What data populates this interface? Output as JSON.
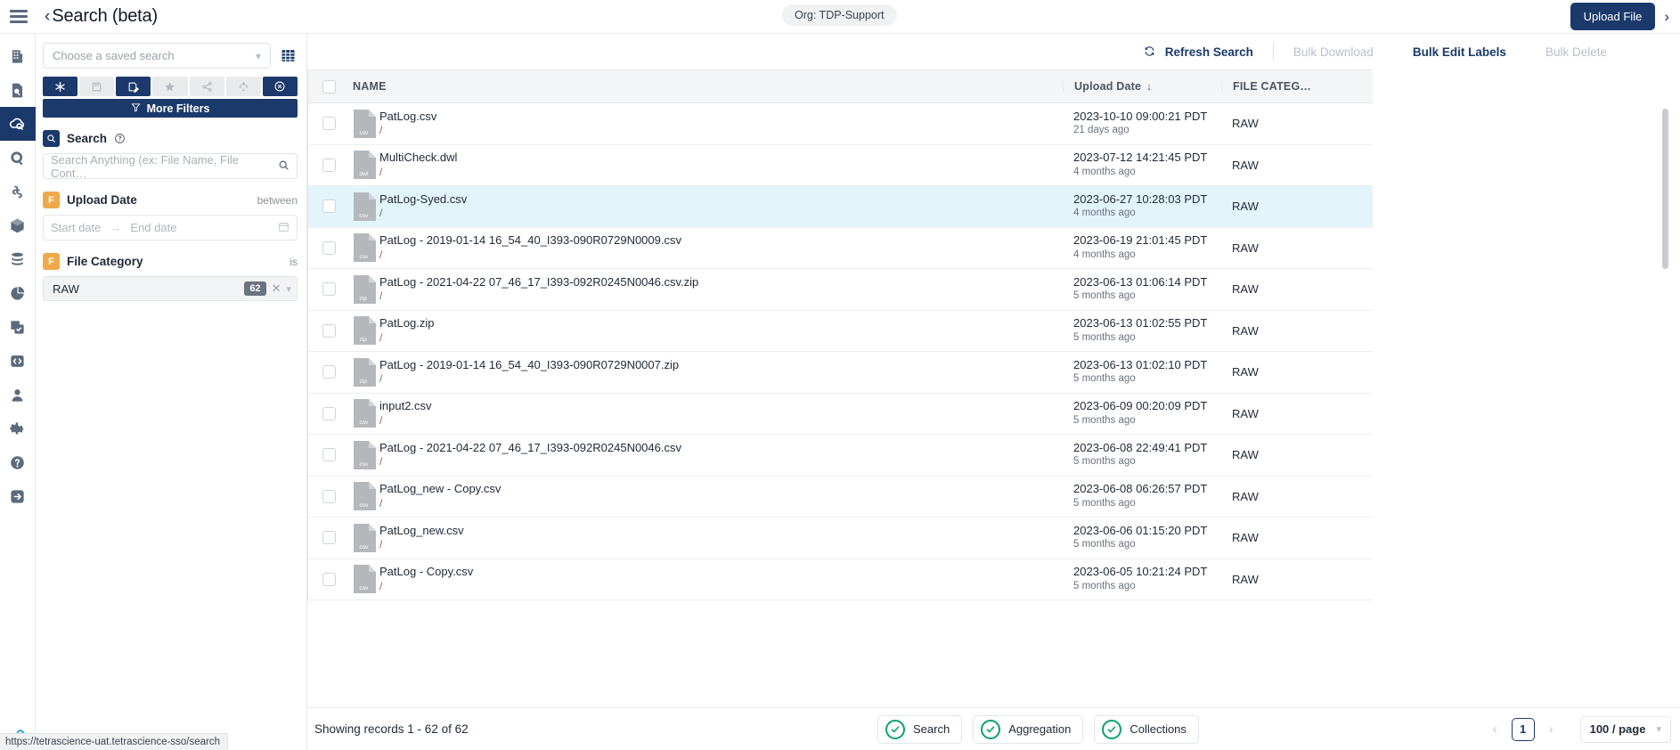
{
  "topbar": {
    "menu_icon": "hamburger-icon",
    "back_icon": "chevron-left-icon",
    "title": "Search (beta)",
    "org_badge": "Org: TDP-Support",
    "upload_label": "Upload File",
    "expand_icon": "chevron-right-icon"
  },
  "rail": {
    "items": [
      {
        "icon": "building-icon",
        "active": false
      },
      {
        "icon": "file-search-icon",
        "active": false
      },
      {
        "icon": "cloud-search-icon",
        "active": true
      },
      {
        "icon": "search-circle-icon",
        "active": false
      },
      {
        "icon": "link-flow-icon",
        "active": false
      },
      {
        "icon": "cube-icon",
        "active": false
      },
      {
        "icon": "database-icon",
        "active": false
      },
      {
        "icon": "pie-chart-icon",
        "active": false
      },
      {
        "icon": "checklist-copy-icon",
        "active": false
      },
      {
        "icon": "code-brackets-icon",
        "active": false
      },
      {
        "icon": "user-icon",
        "active": false
      },
      {
        "icon": "gear-icon",
        "active": false
      },
      {
        "icon": "help-circle-icon",
        "active": false
      },
      {
        "icon": "logout-icon",
        "active": false
      }
    ]
  },
  "filters": {
    "saved_search_placeholder": "Choose a saved search",
    "saved_search_value": "",
    "grid_icon": "grid-icon",
    "quick_buttons": [
      {
        "name": "new-search-button",
        "icon": "asterisk-icon",
        "state": "active"
      },
      {
        "name": "save-search-button",
        "icon": "floppy-icon",
        "state": "disabled"
      },
      {
        "name": "edit-search-button",
        "icon": "save-edit-icon",
        "state": "active"
      },
      {
        "name": "favorite-button",
        "icon": "star-icon",
        "state": "disabled"
      },
      {
        "name": "share-button",
        "icon": "share-icon",
        "state": "disabled"
      },
      {
        "name": "recycle-button",
        "icon": "recycle-icon",
        "state": "disabled"
      },
      {
        "name": "clear-search-button",
        "icon": "close-circle-icon",
        "state": "active"
      }
    ],
    "more_filters_label": "More Filters",
    "more_filters_icon": "funnel-icon",
    "search_section": {
      "badge_icon": "search-icon",
      "label": "Search",
      "help_icon": "question-circle-icon",
      "placeholder": "Search Anything (ex: File Name, File Cont…",
      "value": "",
      "input_icon": "search-icon"
    },
    "upload_date_section": {
      "badge": "F",
      "label": "Upload Date",
      "operator": "between",
      "start_placeholder": "Start date",
      "end_placeholder": "End date",
      "arrow": "→",
      "calendar_icon": "calendar-icon"
    },
    "file_category_section": {
      "badge": "F",
      "label": "File Category",
      "operator": "is",
      "value": "RAW",
      "count": "62",
      "clear_icon": "close-icon",
      "chevron_icon": "chevron-down-icon"
    }
  },
  "actions": {
    "refresh": {
      "label": "Refresh Search",
      "icon": "refresh-icon",
      "enabled": true
    },
    "bulk_download": {
      "label": "Bulk Download",
      "enabled": false
    },
    "bulk_edit_labels": {
      "label": "Bulk Edit Labels",
      "enabled": true
    },
    "bulk_delete": {
      "label": "Bulk Delete",
      "enabled": false
    }
  },
  "table": {
    "columns": {
      "name": "NAME",
      "upload_date": "Upload Date",
      "sort_icon": "arrow-down-icon",
      "file_category": "FILE CATEG…"
    },
    "rows": [
      {
        "name": "PatLog.csv",
        "path": "/",
        "ext": "csv",
        "date": "2023-10-10 09:00:21 PDT",
        "ago": "21 days ago",
        "category": "RAW",
        "selected": false
      },
      {
        "name": "MultiCheck.dwl",
        "path": "/",
        "ext": "dwl",
        "date": "2023-07-12 14:21:45 PDT",
        "ago": "4 months ago",
        "category": "RAW",
        "selected": false
      },
      {
        "name": "PatLog-Syed.csv",
        "path": "/",
        "ext": "csv",
        "date": "2023-06-27 10:28:03 PDT",
        "ago": "4 months ago",
        "category": "RAW",
        "selected": true
      },
      {
        "name": "PatLog - 2019-01-14 16_54_40_I393-090R0729N0009.csv",
        "path": "/",
        "ext": "csv",
        "date": "2023-06-19 21:01:45 PDT",
        "ago": "4 months ago",
        "category": "RAW",
        "selected": false
      },
      {
        "name": "PatLog - 2021-04-22 07_46_17_I393-092R0245N0046.csv.zip",
        "path": "/",
        "ext": "zip",
        "date": "2023-06-13 01:06:14 PDT",
        "ago": "5 months ago",
        "category": "RAW",
        "selected": false
      },
      {
        "name": "PatLog.zip",
        "path": "/",
        "ext": "zip",
        "date": "2023-06-13 01:02:55 PDT",
        "ago": "5 months ago",
        "category": "RAW",
        "selected": false
      },
      {
        "name": "PatLog - 2019-01-14 16_54_40_I393-090R0729N0007.zip",
        "path": "/",
        "ext": "zip",
        "date": "2023-06-13 01:02:10 PDT",
        "ago": "5 months ago",
        "category": "RAW",
        "selected": false
      },
      {
        "name": "input2.csv",
        "path": "/",
        "ext": "csv",
        "date": "2023-06-09 00:20:09 PDT",
        "ago": "5 months ago",
        "category": "RAW",
        "selected": false
      },
      {
        "name": "PatLog - 2021-04-22 07_46_17_I393-092R0245N0046.csv",
        "path": "/",
        "ext": "csv",
        "date": "2023-06-08 22:49:41 PDT",
        "ago": "5 months ago",
        "category": "RAW",
        "selected": false
      },
      {
        "name": "PatLog_new - Copy.csv",
        "path": "/",
        "ext": "csv",
        "date": "2023-06-08 06:26:57 PDT",
        "ago": "5 months ago",
        "category": "RAW",
        "selected": false
      },
      {
        "name": "PatLog_new.csv",
        "path": "/",
        "ext": "csv",
        "date": "2023-06-06 01:15:20 PDT",
        "ago": "5 months ago",
        "category": "RAW",
        "selected": false
      },
      {
        "name": "PatLog - Copy.csv",
        "path": "/",
        "ext": "csv",
        "date": "2023-06-05 10:21:24 PDT",
        "ago": "5 months ago",
        "category": "RAW",
        "selected": false
      }
    ]
  },
  "footer": {
    "records": "Showing records 1 - 62 of 62",
    "chips": [
      {
        "label": "Search",
        "icon": "check-circle-icon"
      },
      {
        "label": "Aggregation",
        "icon": "check-circle-icon"
      },
      {
        "label": "Collections",
        "icon": "check-circle-icon"
      }
    ],
    "prev_icon": "chevron-left-icon",
    "page": "1",
    "next_icon": "chevron-right-icon",
    "per_page": "100 / page",
    "per_page_chevron": "chevron-down-icon"
  },
  "statusbar": {
    "url": "https://tetrascience-uat.tetrascience-sso/search"
  },
  "colors": {
    "brand_navy": "#1b3a6b",
    "filter_orange": "#f0a94a",
    "row_selected": "#e4f4fb",
    "check_green": "#0aa06e"
  }
}
